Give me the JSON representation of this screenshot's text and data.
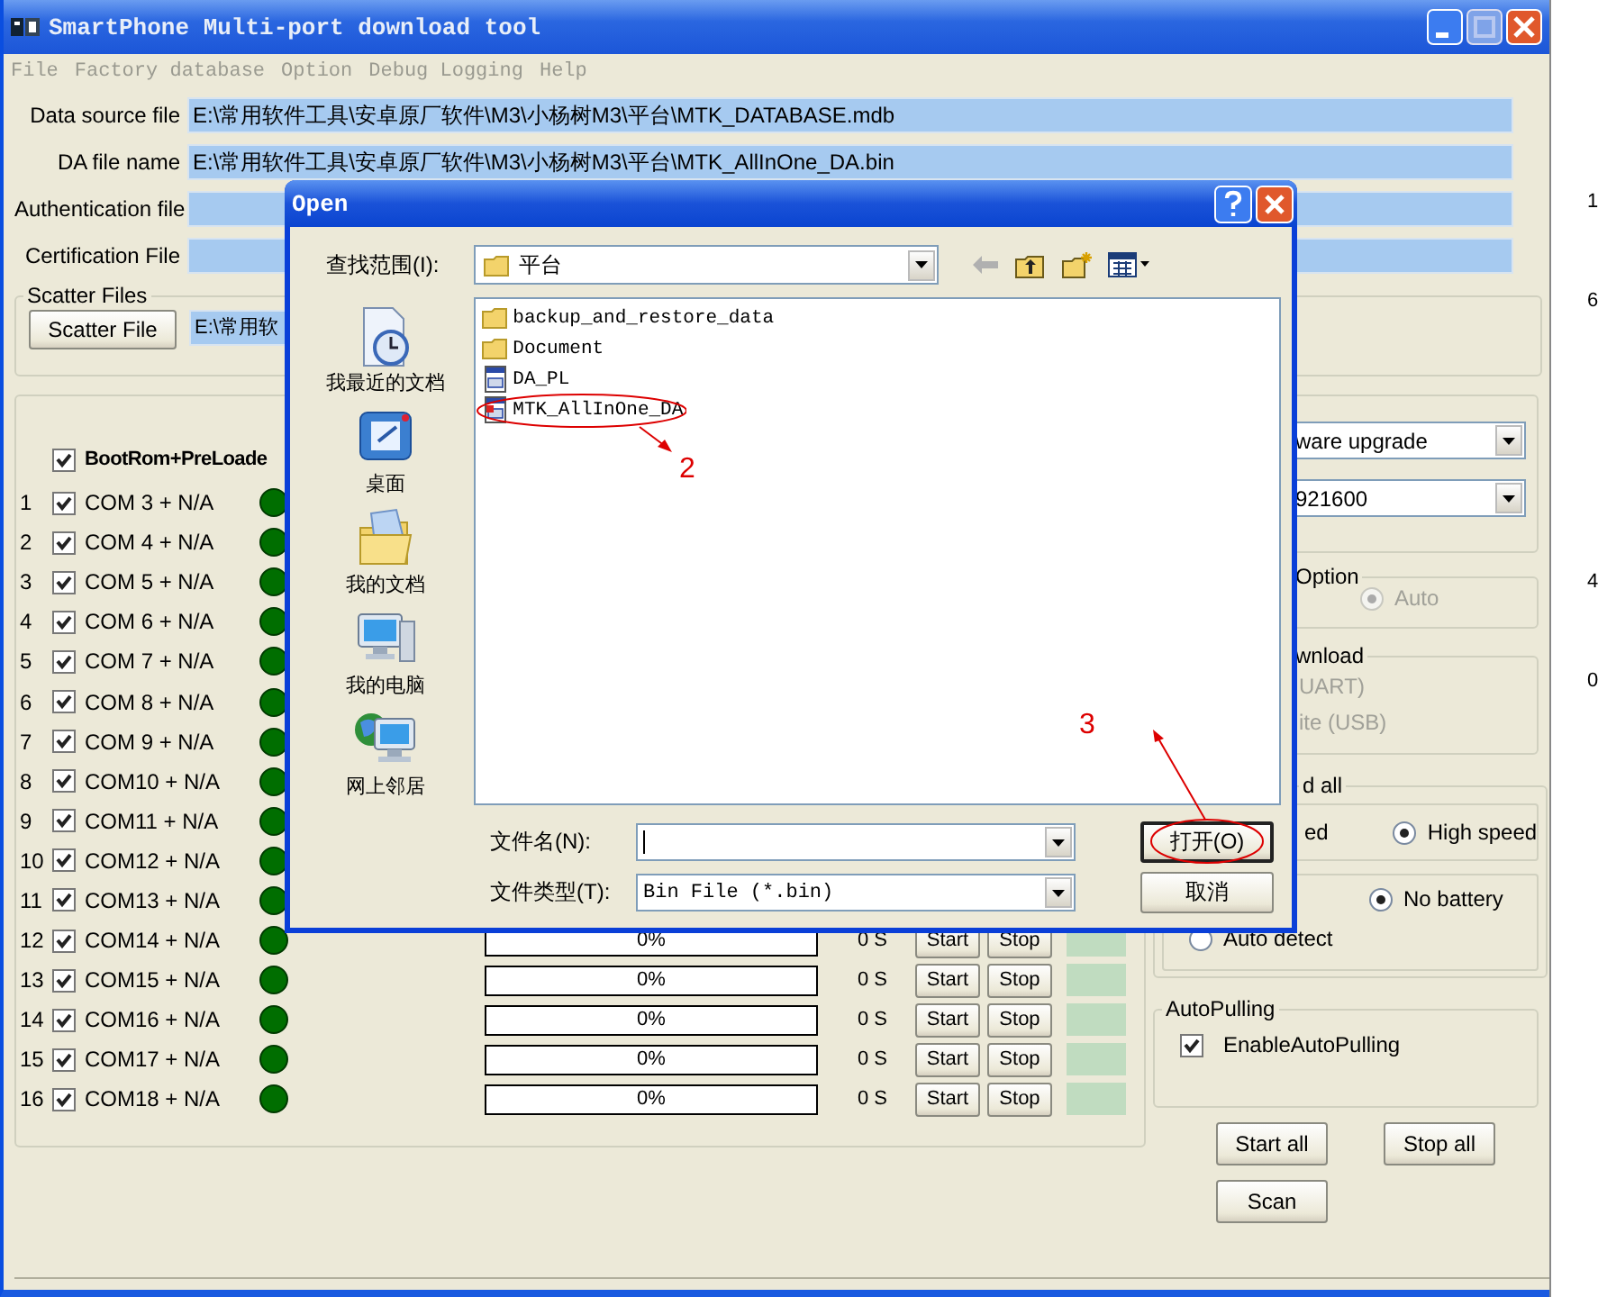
{
  "window": {
    "title": "SmartPhone Multi-port download tool"
  },
  "menu": [
    {
      "label": "File",
      "disabled": true
    },
    {
      "label": "Factory database",
      "disabled": true
    },
    {
      "label": "Option",
      "disabled": true
    },
    {
      "label": "Debug Logging",
      "disabled": true
    },
    {
      "label": "Help",
      "disabled": true
    }
  ],
  "file_fields": [
    {
      "label": "Data source file",
      "value": "E:\\常用软件工具\\安卓原厂软件\\M3\\小杨树M3\\平台\\MTK_DATABASE.mdb"
    },
    {
      "label": "DA file name",
      "value": "E:\\常用软件工具\\安卓原厂软件\\M3\\小杨树M3\\平台\\MTK_AllInOne_DA.bin"
    },
    {
      "label": "Authentication file"
    },
    {
      "label": "Certification File"
    }
  ],
  "scatter": {
    "title": "Scatter Files",
    "button": "Scatter File",
    "value": "E:\\常用软"
  },
  "ports": {
    "header": {
      "label": "BootRom+PreLoade",
      "checked": true
    },
    "rows": [
      {
        "index": "1",
        "label": "COM 3 + N/A",
        "checked": true
      },
      {
        "index": "2",
        "label": "COM 4 + N/A",
        "checked": true
      },
      {
        "index": "3",
        "label": "COM 5 + N/A",
        "checked": true
      },
      {
        "index": "4",
        "label": "COM 6 + N/A",
        "checked": true
      },
      {
        "index": "5",
        "label": "COM 7 + N/A",
        "checked": true
      },
      {
        "index": "6",
        "label": "COM 8 + N/A",
        "checked": true
      },
      {
        "index": "7",
        "label": "COM 9 + N/A",
        "checked": true
      },
      {
        "index": "8",
        "label": "COM10 + N/A",
        "checked": true
      },
      {
        "index": "9",
        "label": "COM11 + N/A",
        "checked": true
      },
      {
        "index": "10",
        "label": "COM12 + N/A",
        "checked": true
      },
      {
        "index": "11",
        "label": "COM13 + N/A",
        "checked": true
      },
      {
        "index": "12",
        "label": "COM14 + N/A",
        "checked": true,
        "progress": {
          "level": 0,
          "text": "0%"
        },
        "time": "0 S",
        "start": "Start",
        "stop": "Stop"
      },
      {
        "index": "13",
        "label": "COM15 + N/A",
        "checked": true,
        "progress": {
          "level": 0,
          "text": "0%"
        },
        "time": "0 S",
        "start": "Start",
        "stop": "Stop"
      },
      {
        "index": "14",
        "label": "COM16 + N/A",
        "checked": true,
        "progress": {
          "level": 0,
          "text": "0%"
        },
        "time": "0 S",
        "start": "Start",
        "stop": "Stop"
      },
      {
        "index": "15",
        "label": "COM17 + N/A",
        "checked": true,
        "progress": {
          "level": 0,
          "text": "0%"
        },
        "time": "0 S",
        "start": "Start",
        "stop": "Stop"
      },
      {
        "index": "16",
        "label": "COM18 + N/A",
        "checked": true,
        "progress": {
          "level": 0,
          "text": "0%"
        },
        "time": "0 S",
        "start": "Start",
        "stop": "Stop"
      }
    ]
  },
  "settings": {
    "mode_combo": "ware upgrade",
    "baud_combo": "921600",
    "option_group": {
      "title": "Option",
      "radio": {
        "label": "Auto",
        "selected": true,
        "disabled": true
      }
    },
    "download_group": {
      "title": "wnload",
      "items": [
        {
          "label": "UART)",
          "disabled": true
        },
        {
          "label": "ite (USB)",
          "disabled": true
        }
      ]
    },
    "speed_group": {
      "title": "d all",
      "speed": [
        {
          "label": "ed"
        },
        {
          "label": "High speed",
          "selected": true
        }
      ],
      "battery": [
        {
          "label": "No battery",
          "selected": true
        },
        {
          "label": "Auto detect",
          "selected": false
        }
      ]
    },
    "autopulling": {
      "title": "AutoPulling",
      "checkbox": {
        "label": "EnableAutoPulling",
        "checked": true
      }
    },
    "buttons": [
      "Start all",
      "Stop all",
      "Scan"
    ]
  },
  "background_window": {
    "fragments": [
      "1",
      "6",
      "4",
      "0"
    ]
  },
  "dialog": {
    "title": "Open",
    "look_in_label": "查找范围(I):",
    "look_in": "平台",
    "places": [
      "我最近的文档",
      "桌面",
      "我的文档",
      "我的电脑",
      "网上邻居"
    ],
    "files": [
      {
        "name": "backup_and_restore_data",
        "kind": "folder"
      },
      {
        "name": "Document",
        "kind": "folder"
      },
      {
        "name": "DA_PL",
        "kind": "file"
      },
      {
        "name": "MTK_AllInOne_DA",
        "kind": "file"
      }
    ],
    "file_name_label": "文件名(N):",
    "file_type_label": "文件类型(T):",
    "file_type": "Bin File (*.bin)",
    "buttons": [
      "打开(O)",
      "取消"
    ]
  },
  "annotations": [
    {
      "label": "2"
    },
    {
      "label": "3"
    }
  ]
}
